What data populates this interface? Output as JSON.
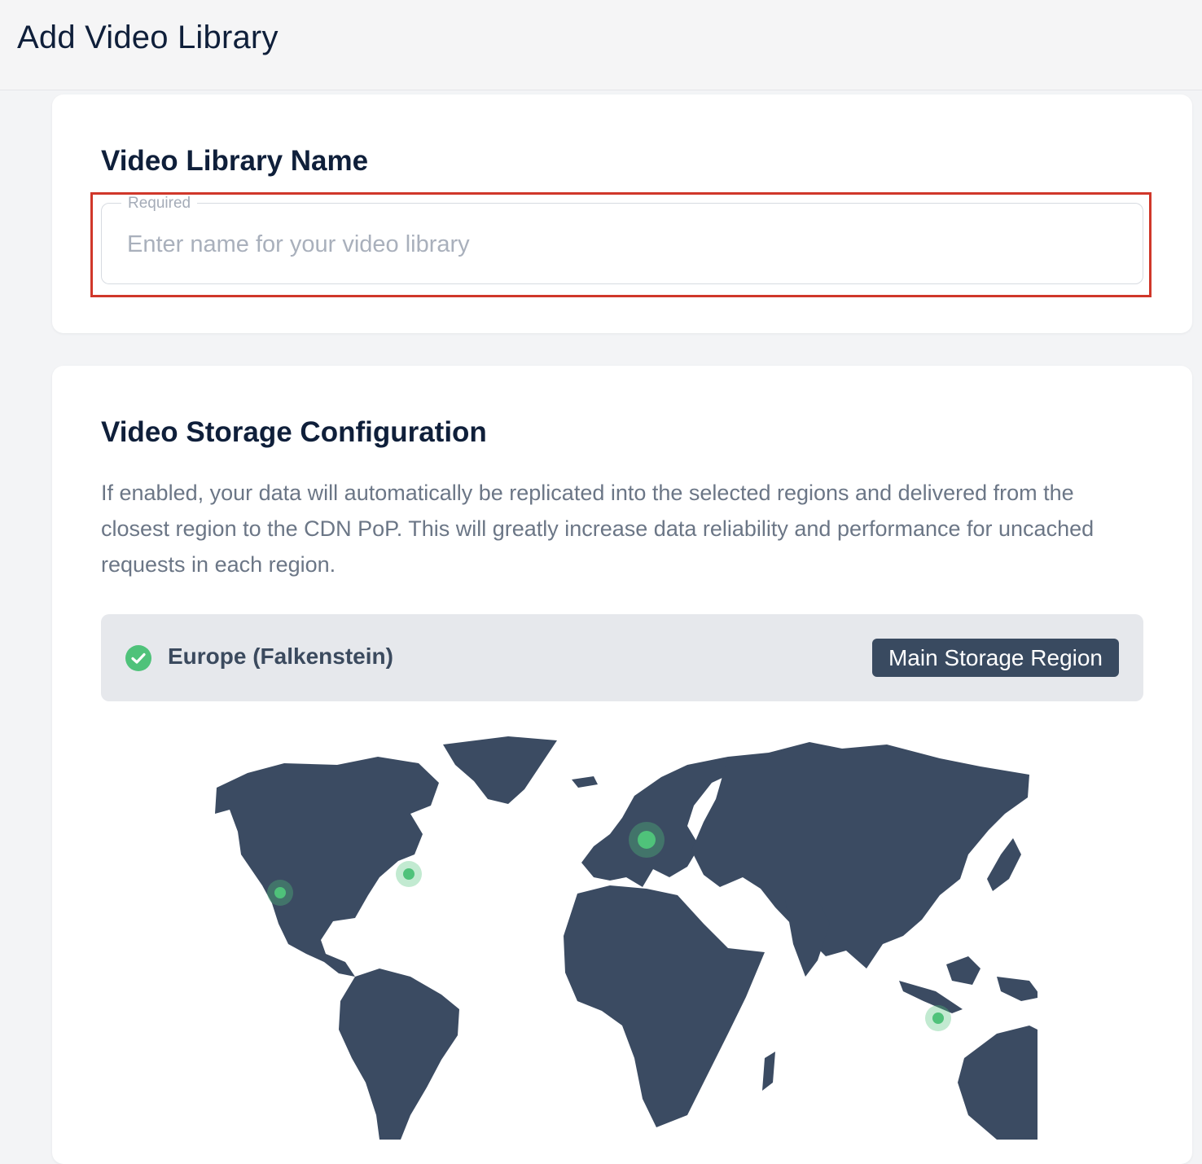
{
  "page": {
    "title": "Add Video Library"
  },
  "name_section": {
    "title": "Video Library Name",
    "field_label": "Required",
    "placeholder": "Enter name for your video library",
    "value": ""
  },
  "storage_section": {
    "title": "Video Storage Configuration",
    "description": "If enabled, your data will automatically be replicated into the selected regions and delivered from the closest region to the CDN PoP. This will greatly increase data reliability and performance for uncached requests in each region.",
    "main_region": {
      "name": "Europe (Falkenstein)",
      "badge": "Main Storage Region",
      "selected": true
    }
  },
  "colors": {
    "accent_green": "#4fc27a",
    "map_land": "#3b4b62",
    "badge_bg": "#394a60",
    "highlight_border": "#d0372a"
  },
  "icons": {
    "region_check": "check-circle-icon"
  }
}
